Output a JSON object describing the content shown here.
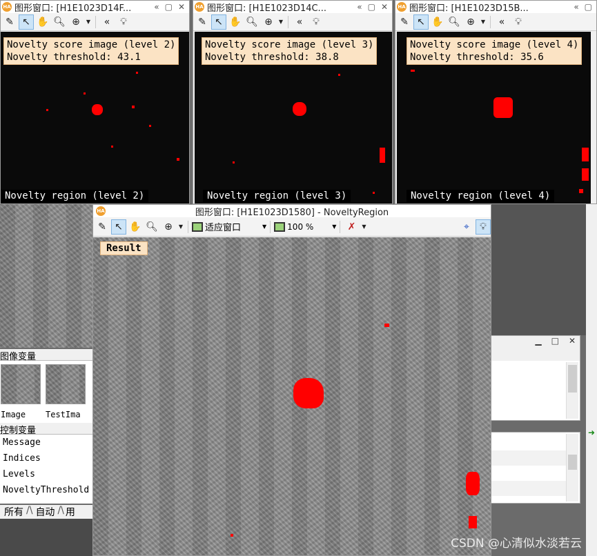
{
  "windows": {
    "w1": {
      "title": "图形窗口: [H1E1023D14F...",
      "score_title": "Novelty score image (level 2)",
      "threshold": "Novelty threshold: 43.1",
      "region": "Novelty region (level 2)"
    },
    "w2": {
      "title": "图形窗口: [H1E1023D14C...",
      "score_title": "Novelty score image (level 3)",
      "threshold": "Novelty threshold: 38.8",
      "region": "Novelty region (level 3)"
    },
    "w3": {
      "title": "图形窗口: [H1E1023D15B...",
      "score_title": "Novelty score image (level 4)",
      "threshold": "Novelty threshold: 35.6",
      "region": "Novelty region (level 4)"
    },
    "main": {
      "title": "图形窗口: [H1E1023D1580] - NoveltyRegion",
      "fit_label": "适应窗口",
      "zoom_label": "100 %",
      "result_label": "Result"
    }
  },
  "small_ctrls": {
    "collapse": "«",
    "pin": "▢",
    "close": "✕"
  },
  "left_panel": {
    "image_vars_header": "图像变量",
    "thumbs": [
      "Image",
      "TestIma"
    ],
    "ctrl_vars_header": "控制变量",
    "ctrl_vars": [
      "Message",
      "Indices",
      "Levels",
      "NoveltyThreshold"
    ],
    "tabs": [
      "所有",
      "自动",
      "用"
    ]
  },
  "watermark": "CSDN @心清似水淡若云",
  "colors": {
    "accent_red": "#ff0000",
    "label_bg": "#fbe3c4"
  }
}
